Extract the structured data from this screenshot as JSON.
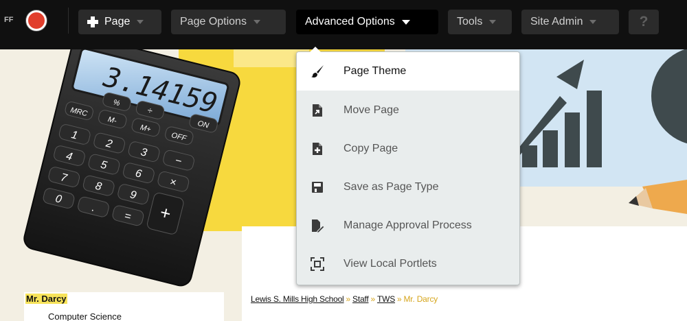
{
  "toolbar": {
    "edit_toggle_label": "FF",
    "add_page_label": "Page",
    "page_options_label": "Page Options",
    "advanced_options_label": "Advanced Options",
    "tools_label": "Tools",
    "site_admin_label": "Site Admin",
    "help_label": "?"
  },
  "banner": {
    "calculator_display": "3.14159",
    "calculator_keys": [
      "MRC",
      "M-",
      "M+",
      "OFF",
      "ON",
      "%",
      "÷",
      "−",
      "1",
      "2",
      "3",
      "4",
      "5",
      "6",
      "7",
      "8",
      "9",
      "0",
      ".",
      "=",
      "+",
      "×"
    ]
  },
  "dropdown": {
    "items": [
      {
        "label": "Page Theme",
        "icon": "brush-icon"
      },
      {
        "label": "Move Page",
        "icon": "move-page-icon"
      },
      {
        "label": "Copy Page",
        "icon": "copy-page-icon"
      },
      {
        "label": "Save as Page Type",
        "icon": "save-icon"
      },
      {
        "label": "Manage Approval Process",
        "icon": "approval-edit-icon"
      },
      {
        "label": "View Local Portlets",
        "icon": "portlets-icon"
      }
    ]
  },
  "sidebar": {
    "name": "Mr. Darcy",
    "department": "Computer Science"
  },
  "breadcrumb": {
    "items": [
      "Lewis S. Mills High School",
      "Staff",
      "TWS"
    ],
    "current": "Mr. Darcy",
    "separator": "»"
  },
  "colors": {
    "toolbar_bg": "#101010",
    "active_button": "#000000",
    "toggle_red": "#e13e2c",
    "banner_yellow": "#f7d93e",
    "breadcrumb_accent": "#d6a51c",
    "name_highlight": "#f7e35a"
  }
}
